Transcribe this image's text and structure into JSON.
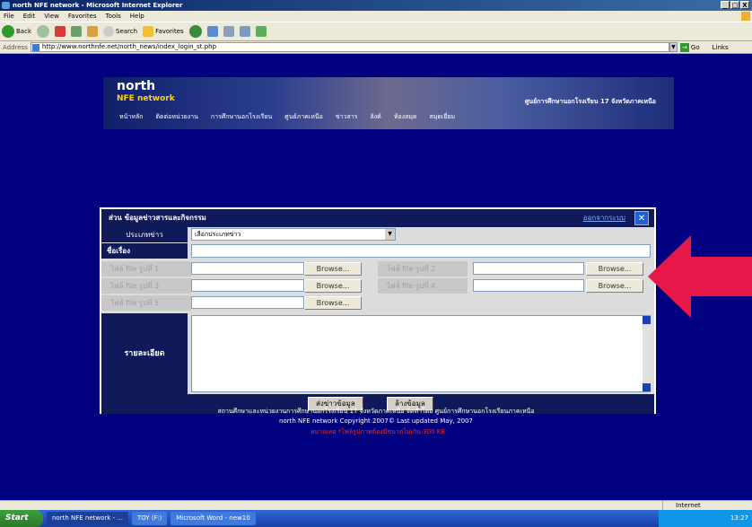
{
  "window": {
    "title": "north NFE network - Microsoft Internet Explorer",
    "controls": [
      "_",
      "□",
      "X"
    ]
  },
  "menu": [
    "File",
    "Edit",
    "View",
    "Favorites",
    "Tools",
    "Help"
  ],
  "toolbar": {
    "back": "Back",
    "search": "Search",
    "favorites": "Favorites"
  },
  "address": {
    "label": "Address",
    "url": "http://www.northnfe.net/north_news/index_login_st.php",
    "go": "Go",
    "links": "Links"
  },
  "site": {
    "logo": "north",
    "logo_sub": "NFE network",
    "banner_text": "ศูนย์การศึกษานอกโรงเรียน 17 จังหวัดภาคเหนือ",
    "nav": [
      "หน้าหลัก",
      "ติดต่อหน่วยงาน",
      "การศึกษานอกโรงเรียน",
      "ศูนย์ภาคเหนือ",
      "ข่าวสาร",
      "ลิงค์",
      "ห้องสมุด",
      "สมุดเยี่ยม"
    ]
  },
  "form": {
    "title": "ส่วน ข้อมูลข่าวสารและกิจกรรม",
    "exit_link": "ออกจากระบบ",
    "type_label": "ประเภทข่าว",
    "type_value": "เลือกประเภทข่าว",
    "subject_label": "ชื่อเรื่อง",
    "file_labels": [
      "ไฟล์ file รูปที่ 1",
      "ไฟล์ file รูปที่ 2",
      "ไฟล์ file รูปที่ 3",
      "ไฟล์ file รูปที่ 4",
      "ไฟล์ file รูปที่ 5"
    ],
    "browse": "Browse...",
    "detail_label": "รายละเอียด",
    "submit": "ส่งข่าวข้อมูล",
    "reset": "ล้างข้อมูล",
    "note": "หมายเหตุ *ไฟล์รูปภาพต้องมีขนาดไม่เกิน 300 KB"
  },
  "footer": {
    "line1": "สถานศึกษาและหน่วยงานการศึกษานอกโรงเรียน 17 จังหวัดภาคเหนือ จัดทำโดย ศูนย์การศึกษานอกโรงเรียนภาคเหนือ",
    "line2": "north NFE network Copyright 2007© Last updated May, 2007"
  },
  "status": {
    "zone": "Internet"
  },
  "taskbar": {
    "start": "Start",
    "tasks": [
      "north NFE network - ...",
      "TOY (F:)",
      "Microsoft Word - new10"
    ],
    "clock": "13:27"
  },
  "colors": {
    "page_bg": "#000080",
    "panel_head": "#101a5a",
    "arrow": "#e8174a"
  }
}
